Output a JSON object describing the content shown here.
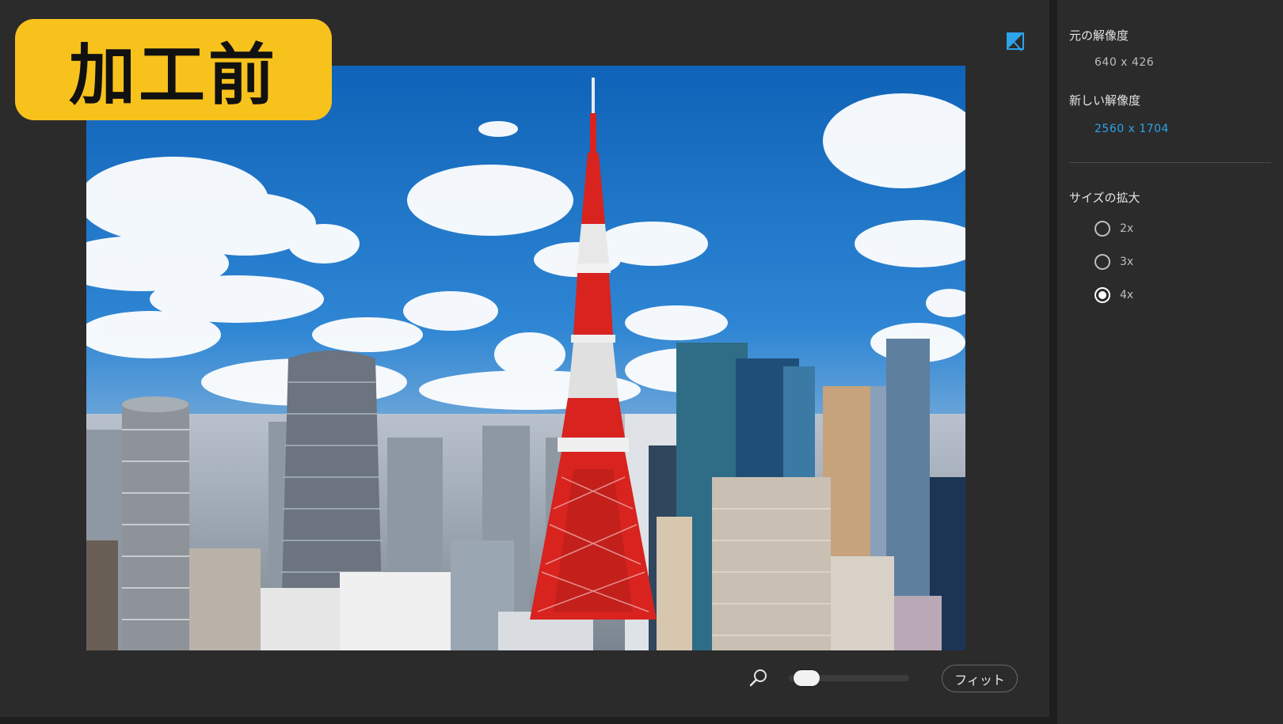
{
  "badge": {
    "label": "加工前"
  },
  "zoom": {
    "fit_label": "フィット",
    "level": 0.05
  },
  "settings": {
    "original_resolution_label": "元の解像度",
    "original_resolution_value": "640  x  426",
    "new_resolution_label": "新しい解像度",
    "new_resolution_value": "2560  x  1704",
    "scale_label": "サイズの拡大",
    "scale_options": [
      {
        "label": "2x",
        "selected": false
      },
      {
        "label": "3x",
        "selected": false
      },
      {
        "label": "4x",
        "selected": true
      }
    ]
  },
  "colors": {
    "accent": "#2ea3ea",
    "badge": "#f8c21d",
    "background": "#2b2b2b",
    "tower_red": "#d8231f"
  },
  "icons": {
    "compare": "compare-toggle-icon",
    "zoom": "magnifier-icon"
  }
}
